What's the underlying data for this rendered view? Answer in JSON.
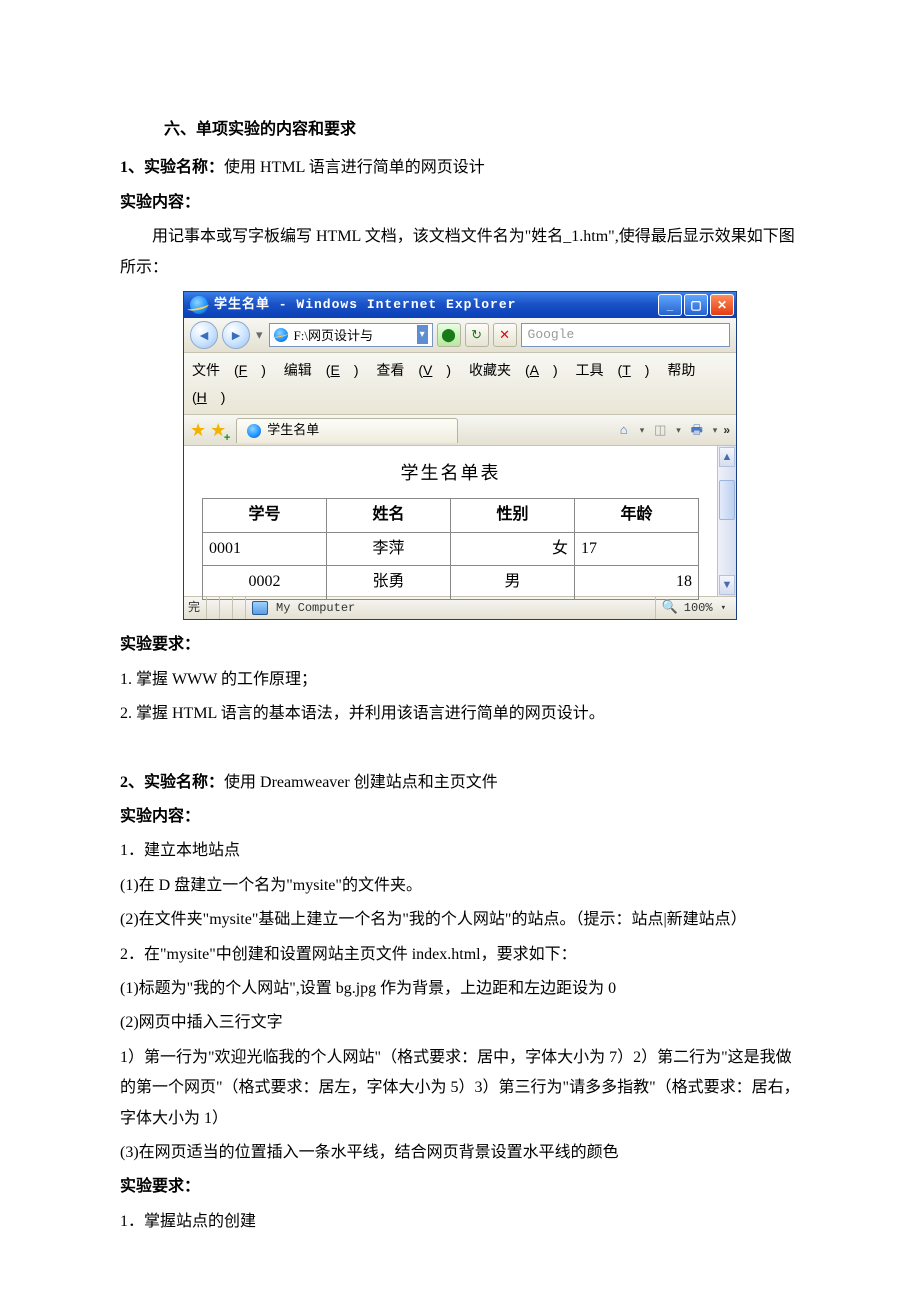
{
  "doc": {
    "section_title": "六、单项实验的内容和要求",
    "exp1": {
      "name_label": "1、实验名称：",
      "name_value": "使用 HTML 语言进行简单的网页设计",
      "content_label": "实验内容：",
      "content_text": "用记事本或写字板编写 HTML 文档，该文档文件名为\"姓名_1.htm\",使得最后显示效果如下图所示：",
      "req_label": "实验要求：",
      "req_items": [
        "1. 掌握 WWW 的工作原理；",
        "2. 掌握 HTML 语言的基本语法，并利用该语言进行简单的网页设计。"
      ]
    },
    "exp2": {
      "name_label": "2、实验名称：",
      "name_value": "使用 Dreamweaver 创建站点和主页文件",
      "content_label": "实验内容：",
      "items": [
        "1．建立本地站点",
        "(1)在 D 盘建立一个名为\"mysite\"的文件夹。",
        "(2)在文件夹\"mysite\"基础上建立一个名为\"我的个人网站\"的站点。（提示：站点|新建站点）",
        "2．在\"mysite\"中创建和设置网站主页文件 index.html，要求如下：",
        "(1)标题为\"我的个人网站\",设置 bg.jpg 作为背景，上边距和左边距设为 0",
        "(2)网页中插入三行文字",
        "1）第一行为\"欢迎光临我的个人网站\"（格式要求：居中，字体大小为 7）2）第二行为\"这是我做的第一个网页\"（格式要求：居左，字体大小为 5）3）第三行为\"请多多指教\"（格式要求：居右，字体大小为 1）",
        "(3)在网页适当的位置插入一条水平线，结合网页背景设置水平线的颜色"
      ],
      "req_label": "实验要求：",
      "req_items": [
        "1．掌握站点的创建"
      ]
    }
  },
  "ie": {
    "title": "学生名单 - Windows Internet Explorer",
    "address": "F:\\网页设计与",
    "search_placeholder": "Google",
    "menus": [
      {
        "t": "文件",
        "k": "F"
      },
      {
        "t": "编辑",
        "k": "E"
      },
      {
        "t": "查看",
        "k": "V"
      },
      {
        "t": "收藏夹",
        "k": "A"
      },
      {
        "t": "工具",
        "k": "T"
      },
      {
        "t": "帮助",
        "k": "H"
      }
    ],
    "tab_label": "学生名单",
    "page": {
      "heading": "学生名单表",
      "columns": [
        "学号",
        "姓名",
        "性别",
        "年龄"
      ],
      "rows": [
        {
          "id": "0001",
          "name": "李萍",
          "gender": "女",
          "age": "17",
          "align": [
            "left",
            "center",
            "right",
            "left"
          ]
        },
        {
          "id": "0002",
          "name": "张勇",
          "gender": "男",
          "age": "18",
          "align": [
            "center",
            "center",
            "center",
            "right"
          ]
        }
      ]
    },
    "status": {
      "done": "完",
      "location": "My Computer",
      "zoom": "100%"
    }
  }
}
